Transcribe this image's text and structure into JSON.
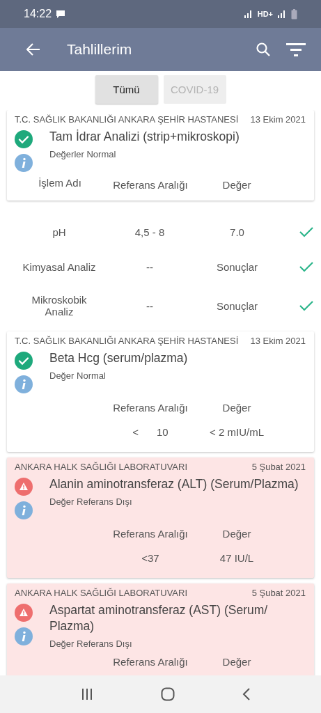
{
  "status_bar": {
    "time": "14:22",
    "network": "HD+"
  },
  "app_bar": {
    "title": "Tahlillerim"
  },
  "filters": [
    {
      "label": "Tümü",
      "selected": true
    },
    {
      "label": "COVID-19",
      "selected": false
    }
  ],
  "tests": [
    {
      "kind": "normal",
      "lab": "T.C. SAĞLIK BAKANLIĞI ANKARA ŞEHİR HASTANESİ",
      "date": "13 Ekim 2021",
      "title": "Tam İdrar Analizi (strip+mikroskopi)",
      "note": "Değerler Normal",
      "columns": {
        "name": "İşlem Adı",
        "range": "Referans Aralığı",
        "value": "Değer"
      },
      "details": [
        {
          "name": "pH",
          "range": "4,5 - 8",
          "value": "7.0",
          "ok": true
        },
        {
          "name": "Kimyasal Analiz",
          "range": "--",
          "value": "Sonuçlar",
          "ok": true
        },
        {
          "name": "Mikroskobik Analiz",
          "range": "--",
          "value": "Sonuçlar",
          "ok": true
        }
      ]
    },
    {
      "kind": "normal",
      "lab": "T.C. SAĞLIK BAKANLIĞI ANKARA ŞEHİR HASTANESİ",
      "date": "13 Ekim 2021",
      "title": "Beta Hcg (serum/plazma)",
      "note": "Değer Normal",
      "columns": {
        "range": "Referans Aralığı",
        "value": "Değer"
      },
      "rows": [
        {
          "range_prefix": "<",
          "range": "10",
          "value": "< 2 mIU/mL"
        }
      ]
    },
    {
      "kind": "abnormal",
      "lab": "ANKARA HALK SAĞLIĞI LABORATUVARI",
      "date": "5 Şubat 2021",
      "title": "Alanin aminotransferaz (ALT) (Serum/Plazma)",
      "note": "Değer Referans Dışı",
      "columns": {
        "range": "Referans Aralığı",
        "value": "Değer"
      },
      "rows": [
        {
          "range": "<37",
          "value": "47 IU/L"
        }
      ]
    },
    {
      "kind": "abnormal",
      "lab": "ANKARA HALK SAĞLIĞI LABORATUVARI",
      "date": "5 Şubat 2021",
      "title": "Aspartat aminotransferaz (AST) (Serum/ Plazma)",
      "note": "Değer Referans Dışı",
      "columns": {
        "range": "Referans Aralığı",
        "value": "Değer"
      }
    }
  ]
}
